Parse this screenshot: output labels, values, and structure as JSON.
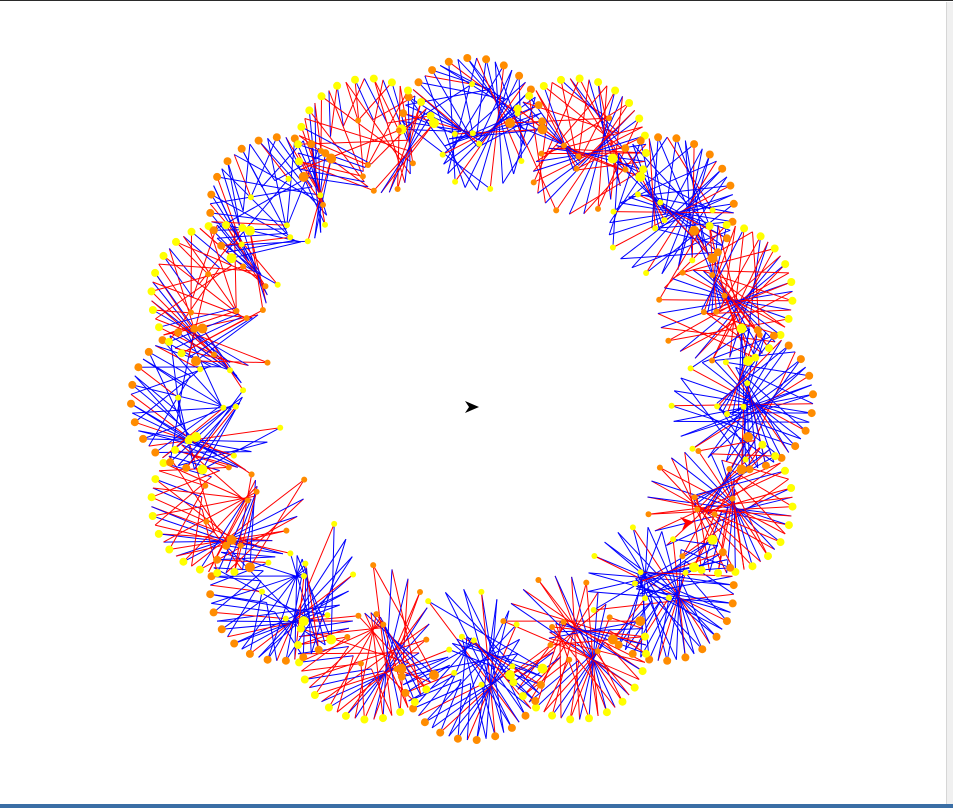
{
  "window": {
    "background": "#ffffff"
  },
  "drawing": {
    "description_colors": {
      "line_a": "#0000ff",
      "line_b": "#ff0000",
      "dot_a": "#ffff00",
      "dot_b": "#ff8c00"
    },
    "petal_count": 16,
    "turtles": [
      {
        "name": "main-turtle",
        "color": "#000000",
        "icon": "turtle-arrow-icon"
      },
      {
        "name": "drawing-turtle",
        "color": "#ff0000",
        "icon": "turtle-arrow-icon"
      }
    ]
  }
}
